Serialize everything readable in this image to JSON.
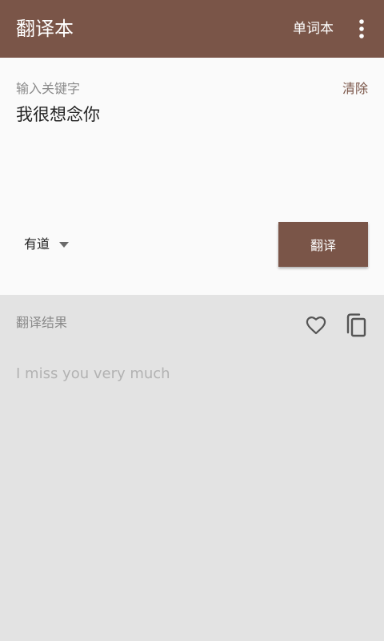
{
  "appbar": {
    "title": "翻译本",
    "action_label": "单词本",
    "overflow_icon": "more-vert-icon",
    "color": "#7a5548"
  },
  "input": {
    "label": "输入关键字",
    "clear_label": "清除",
    "value": "我很想念你",
    "engine": "有道",
    "engine_icon": "dropdown-arrow-icon",
    "translate_label": "翻译"
  },
  "result": {
    "label": "翻译结果",
    "favorite_icon": "heart-outline-icon",
    "copy_icon": "copy-icon",
    "text": "I miss you very much"
  }
}
